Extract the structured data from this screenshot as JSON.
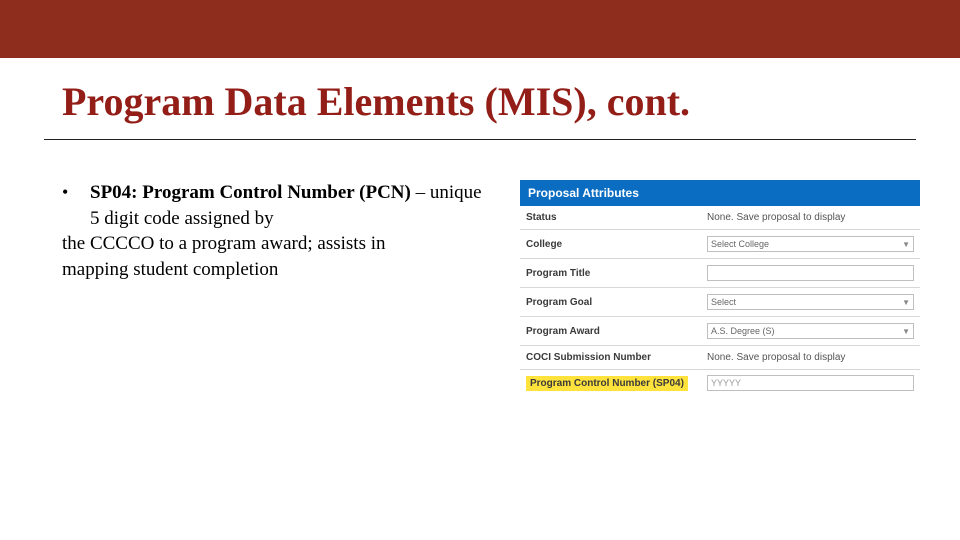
{
  "topbar": {},
  "title": "Program Data Elements (MIS), cont.",
  "bullet": {
    "lead": "SP04: Program Control Number (PCN)",
    "rest_line1": " – unique 5 digit code assigned by",
    "line2": "the CCCCO to a program award; assists in",
    "line3": "mapping student completion"
  },
  "panel": {
    "header": "Proposal Attributes",
    "rows": {
      "status": {
        "label": "Status",
        "value": "None. Save proposal to display"
      },
      "college": {
        "label": "College",
        "select": "Select College"
      },
      "program_title": {
        "label": "Program Title"
      },
      "program_goal": {
        "label": "Program Goal",
        "select": "Select"
      },
      "program_award": {
        "label": "Program Award",
        "select": "A.S. Degree (S)"
      },
      "coci": {
        "label": "COCI Submission Number",
        "value": "None. Save proposal to display"
      },
      "pcn": {
        "label": "Program Control Number (SP04)",
        "placeholder": "YYYYY"
      }
    }
  }
}
